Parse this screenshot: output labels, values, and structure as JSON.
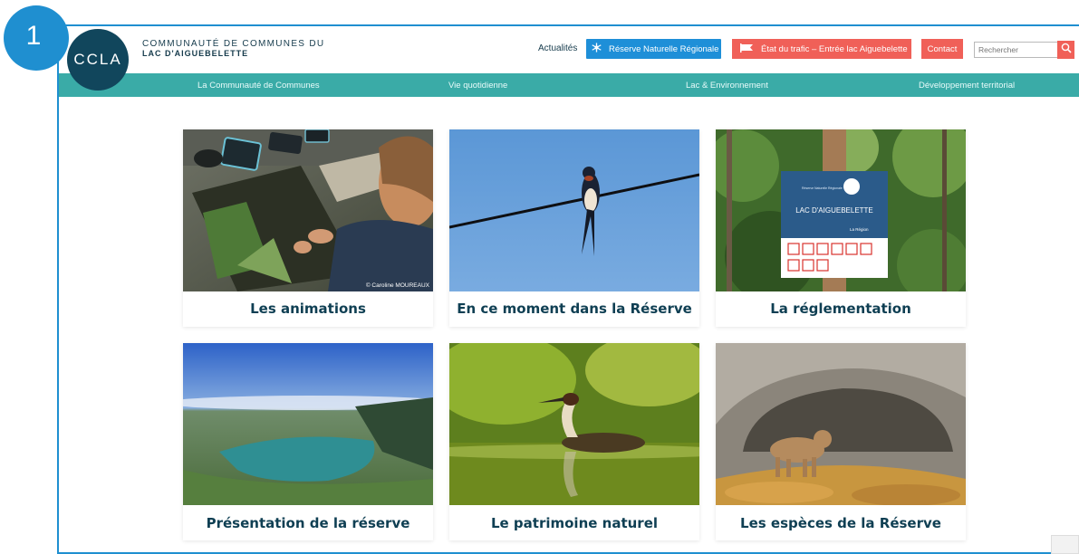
{
  "step": "1",
  "header": {
    "logo_text": "CCLA",
    "org_line1": "COMMUNAUTÉ DE COMMUNES DU",
    "org_line2": "LAC D'AIGUEBELETTE",
    "actualites": "Actualités",
    "reserve_button": "Réserve Naturelle Régionale",
    "trafic_button": "État du trafic – Entrée lac Aiguebelette",
    "contact_button": "Contact",
    "search_placeholder": "Rechercher"
  },
  "nav": {
    "items": [
      "La Communauté de Communes",
      "Vie quotidienne",
      "Lac & Environnement",
      "Développement territorial"
    ]
  },
  "cards": [
    {
      "title": "Les animations",
      "image": "children-reading-books",
      "credit": "© Caroline MOUREAUX"
    },
    {
      "title": "En ce moment dans la Réserve",
      "image": "swallow-on-wire"
    },
    {
      "title": "La réglementation",
      "image": "reserve-sign-in-forest",
      "sign_label": "LAC D'AIGUEBELETTE",
      "sign_sub": "Réserve Naturelle Régionale",
      "sign_region": "La Région"
    },
    {
      "title": "Présentation de la réserve",
      "image": "aerial-lake-view"
    },
    {
      "title": "Le patrimoine naturel",
      "image": "great-crested-grebe"
    },
    {
      "title": "Les espèces de la Réserve",
      "image": "lynx-in-cave"
    }
  ],
  "colors": {
    "accent_blue": "#1e8fd8",
    "teal_nav": "#3aaba7",
    "coral": "#f06058",
    "navy_text": "#0f3f53"
  }
}
